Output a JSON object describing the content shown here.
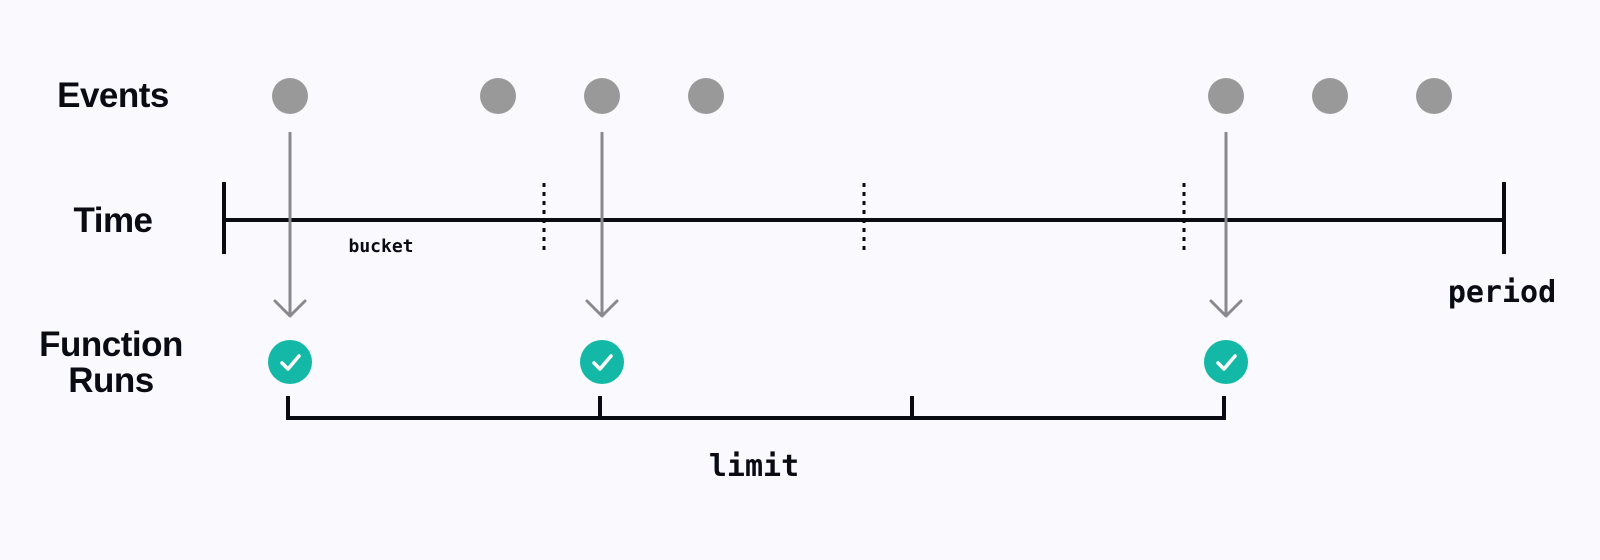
{
  "labels": {
    "events": "Events",
    "time": "Time",
    "function_runs_line1": "Function",
    "function_runs_line2": "Runs",
    "bucket": "bucket",
    "period": "period",
    "limit": "limit"
  },
  "colors": {
    "background": "#f9f9fe",
    "ink": "#0b0b14",
    "event_dot": "#999999",
    "arrow": "#8a8a8e",
    "run_success": "#14b8a6",
    "check": "#ffffff"
  },
  "timeline": {
    "buckets": 4,
    "unit": "event slot",
    "slots_per_bucket": 3.077
  },
  "events": [
    {
      "slot": 0,
      "triggered_run": true
    },
    {
      "slot": 2,
      "triggered_run": false
    },
    {
      "slot": 3,
      "triggered_run": true
    },
    {
      "slot": 4,
      "triggered_run": false
    },
    {
      "slot": 9,
      "triggered_run": true
    },
    {
      "slot": 10,
      "triggered_run": false
    },
    {
      "slot": 11,
      "triggered_run": false
    }
  ],
  "runs": [
    {
      "slot": 0,
      "status": "success"
    },
    {
      "slot": 3,
      "status": "success"
    },
    {
      "slot": 9,
      "status": "success"
    }
  ],
  "limit_ticks": [
    0,
    3,
    6,
    9
  ]
}
